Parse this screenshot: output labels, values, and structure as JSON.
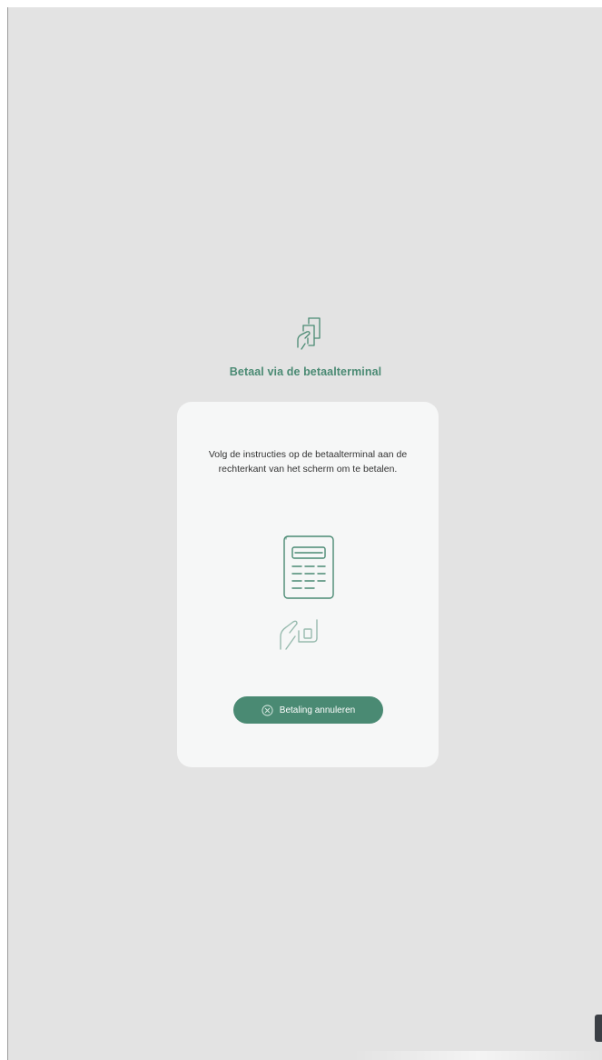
{
  "header": {
    "title": "Betaal via de betaalterminal",
    "icon": "card-payment-icon"
  },
  "card": {
    "instructions": "Volg de instructies op de betaalterminal aan de rechterkant van het scherm om te betalen.",
    "illustration": "payment-terminal-icon",
    "cancel_button": {
      "label": "Betaling annuleren",
      "icon": "close-circle-icon"
    }
  },
  "colors": {
    "accent": "#4a8a73",
    "background": "#e3e3e3",
    "card": "#f6f7f7"
  }
}
